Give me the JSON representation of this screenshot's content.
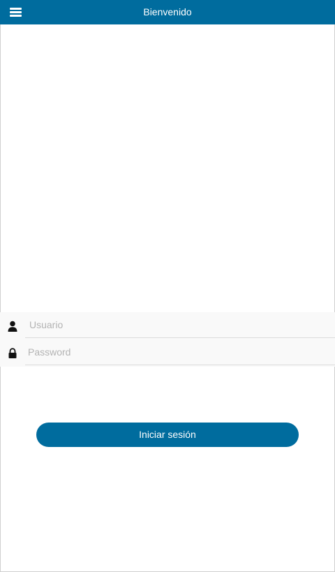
{
  "colors": {
    "accent": "#006c9e",
    "background": "#ffffff",
    "field_background": "#f9f9f9",
    "placeholder": "#b3b3b3"
  },
  "header": {
    "title": "Bienvenido",
    "menu_icon": "hamburger-menu-icon"
  },
  "login": {
    "username": {
      "icon": "user-icon",
      "value": "",
      "placeholder": "Usuario"
    },
    "password": {
      "icon": "lock-icon",
      "value": "",
      "placeholder": "Password"
    },
    "submit_label": "Iniciar sesión"
  }
}
